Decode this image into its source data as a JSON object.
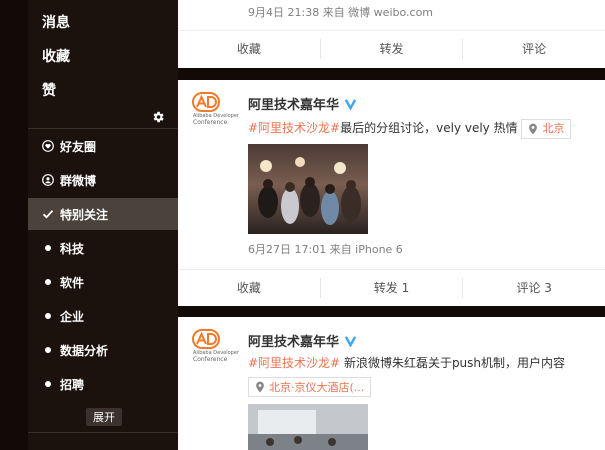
{
  "sidebar": {
    "top_items": [
      {
        "label": "消息"
      },
      {
        "label": "收藏"
      },
      {
        "label": "赞"
      }
    ],
    "groups": [
      {
        "label": "好友圈",
        "icon": "heart-circle-icon"
      },
      {
        "label": "群微博",
        "icon": "person-circle-icon"
      },
      {
        "label": "特别关注",
        "icon": "check-icon",
        "active": true
      },
      {
        "label": "科技",
        "icon": "dot-icon"
      },
      {
        "label": "软件",
        "icon": "dot-icon"
      },
      {
        "label": "企业",
        "icon": "dot-icon"
      },
      {
        "label": "数据分析",
        "icon": "dot-icon"
      },
      {
        "label": "招聘",
        "icon": "dot-icon"
      }
    ],
    "expand_label": "展开"
  },
  "feed": {
    "post0": {
      "meta": "9月4日 21:38 来自 微博 weibo.com",
      "actions": [
        "收藏",
        "转发",
        "评论"
      ]
    },
    "post1": {
      "author": "阿里技术嘉年华",
      "topic": "#阿里技术沙龙#",
      "text": "最后的分组讨论，vely vely 热情",
      "location": "北京",
      "meta": "6月27日 17:01 来自 iPhone 6",
      "actions": [
        "收藏",
        "转发 1",
        "评论 3"
      ]
    },
    "post2": {
      "author": "阿里技术嘉年华",
      "topic": "#阿里技术沙龙#",
      "text": " 新浪微博朱红磊关于push机制，用户内容",
      "location": "北京·京仪大酒店(...",
      "avatar_text": "Alibaba Developer Conference"
    }
  },
  "colors": {
    "sidebar_bg": "#1b120d",
    "accent": "#eb7350",
    "avatar_orange": "#f3792b",
    "verified_blue": "#3ea6ef"
  }
}
